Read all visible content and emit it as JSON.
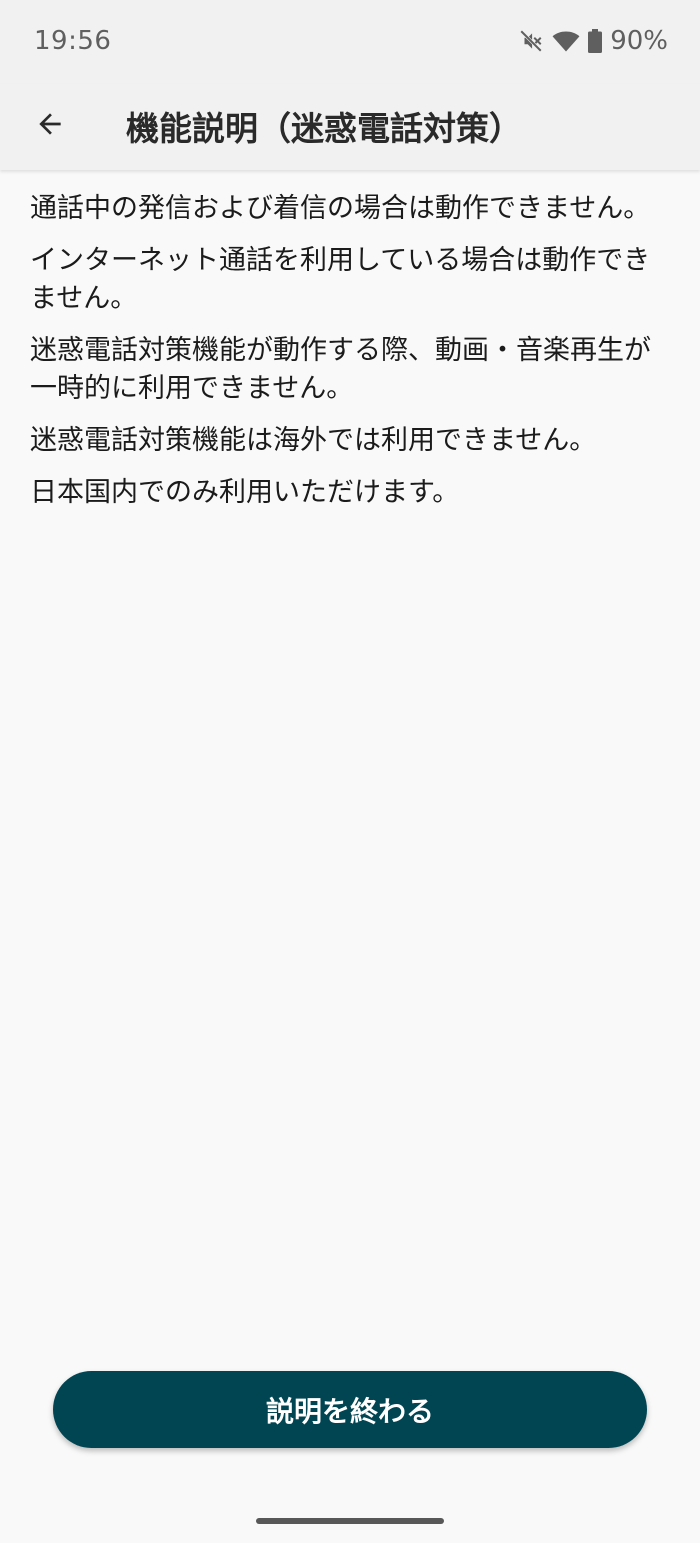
{
  "status_bar": {
    "time": "19:56",
    "battery": "90%",
    "icons": [
      "mute-vibrate-off-icon",
      "wifi-icon",
      "battery-icon"
    ]
  },
  "app_bar": {
    "back_icon": "arrow-left-icon",
    "title": "機能説明（迷惑電話対策）"
  },
  "content": {
    "paragraphs": [
      "通話中の発信および着信の場合は動作できません。",
      "インターネット通話を利用している場合は動作できません。",
      "迷惑電話対策機能が動作する際、動画・音楽再生が一時的に利用できません。",
      "迷惑電話対策機能は海外では利用できません。",
      "日本国内でのみ利用いただけます。"
    ]
  },
  "footer": {
    "end_button_label": "説明を終わる"
  },
  "colors": {
    "button_background": "#014553",
    "page_background": "#f9f9f9",
    "bar_background": "#f1f1f1"
  }
}
